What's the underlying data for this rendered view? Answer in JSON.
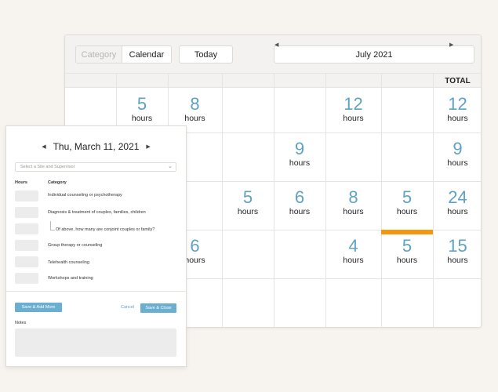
{
  "calendar": {
    "category_label": "Category",
    "calendar_label": "Calendar",
    "today_label": "Today",
    "month_label": "July 2021",
    "prev_arrow": "◀",
    "next_arrow": "▶",
    "total_label": "TOTAL",
    "unit": "hours",
    "highlight_color": "#f5960f",
    "number_color": "#5fa2c2",
    "rows": [
      [
        "",
        "5",
        "8",
        "",
        "",
        "12",
        "",
        "12"
      ],
      [
        "",
        "",
        "",
        "",
        "9",
        "",
        "",
        "9"
      ],
      [
        "",
        "",
        "",
        "5",
        "6",
        "8",
        "5",
        "24"
      ],
      [
        "",
        "",
        "6",
        "",
        "",
        "4",
        "5",
        "15"
      ],
      [
        "",
        "",
        "",
        "",
        "",
        "",
        "",
        ""
      ]
    ]
  },
  "form": {
    "date_label": "Thu, March 11, 2021",
    "prev_arrow": "◀",
    "next_arrow": "▶",
    "site_placeholder": "Select a Site and Supervisor",
    "hours_header": "Hours",
    "category_header": "Category",
    "categories": [
      "Individual counseling or psychotherapy",
      "Diagnosis & treatment of couples, families, children",
      "Of above, how many are conjoint couples or family?",
      "Group therapy or counseling",
      "Telehealth counseling",
      "Workshops and training"
    ],
    "save_add_more": "Save & Add More",
    "cancel": "Cancel",
    "save_close": "Save & Close",
    "notes_label": "Notes"
  }
}
